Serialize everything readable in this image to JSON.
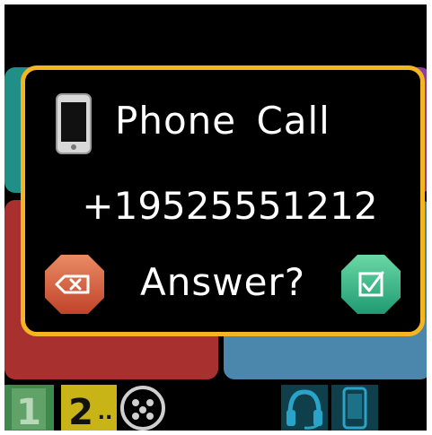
{
  "dialog": {
    "title": "Phone Call",
    "number": "+19525551212",
    "prompt": "Answer?",
    "title_icon": "phone-icon",
    "reject_icon": "backspace-icon",
    "accept_icon": "checkbox-icon"
  },
  "bottom_bar": {
    "items": [
      {
        "label": "1",
        "icon": "slot-1-icon"
      },
      {
        "label": "2..",
        "icon": "slot-2-icon"
      },
      {
        "icon": "controller-icon"
      },
      {
        "icon": "headset-icon"
      },
      {
        "icon": "phone-icon"
      }
    ]
  },
  "colors": {
    "border": "#f4b521",
    "teal": "#1f8f87",
    "purple": "#8d3f9c",
    "red": "#a8312f",
    "blue": "#4b86ad",
    "accept": "#2db38a",
    "reject": "#d65a3a"
  }
}
